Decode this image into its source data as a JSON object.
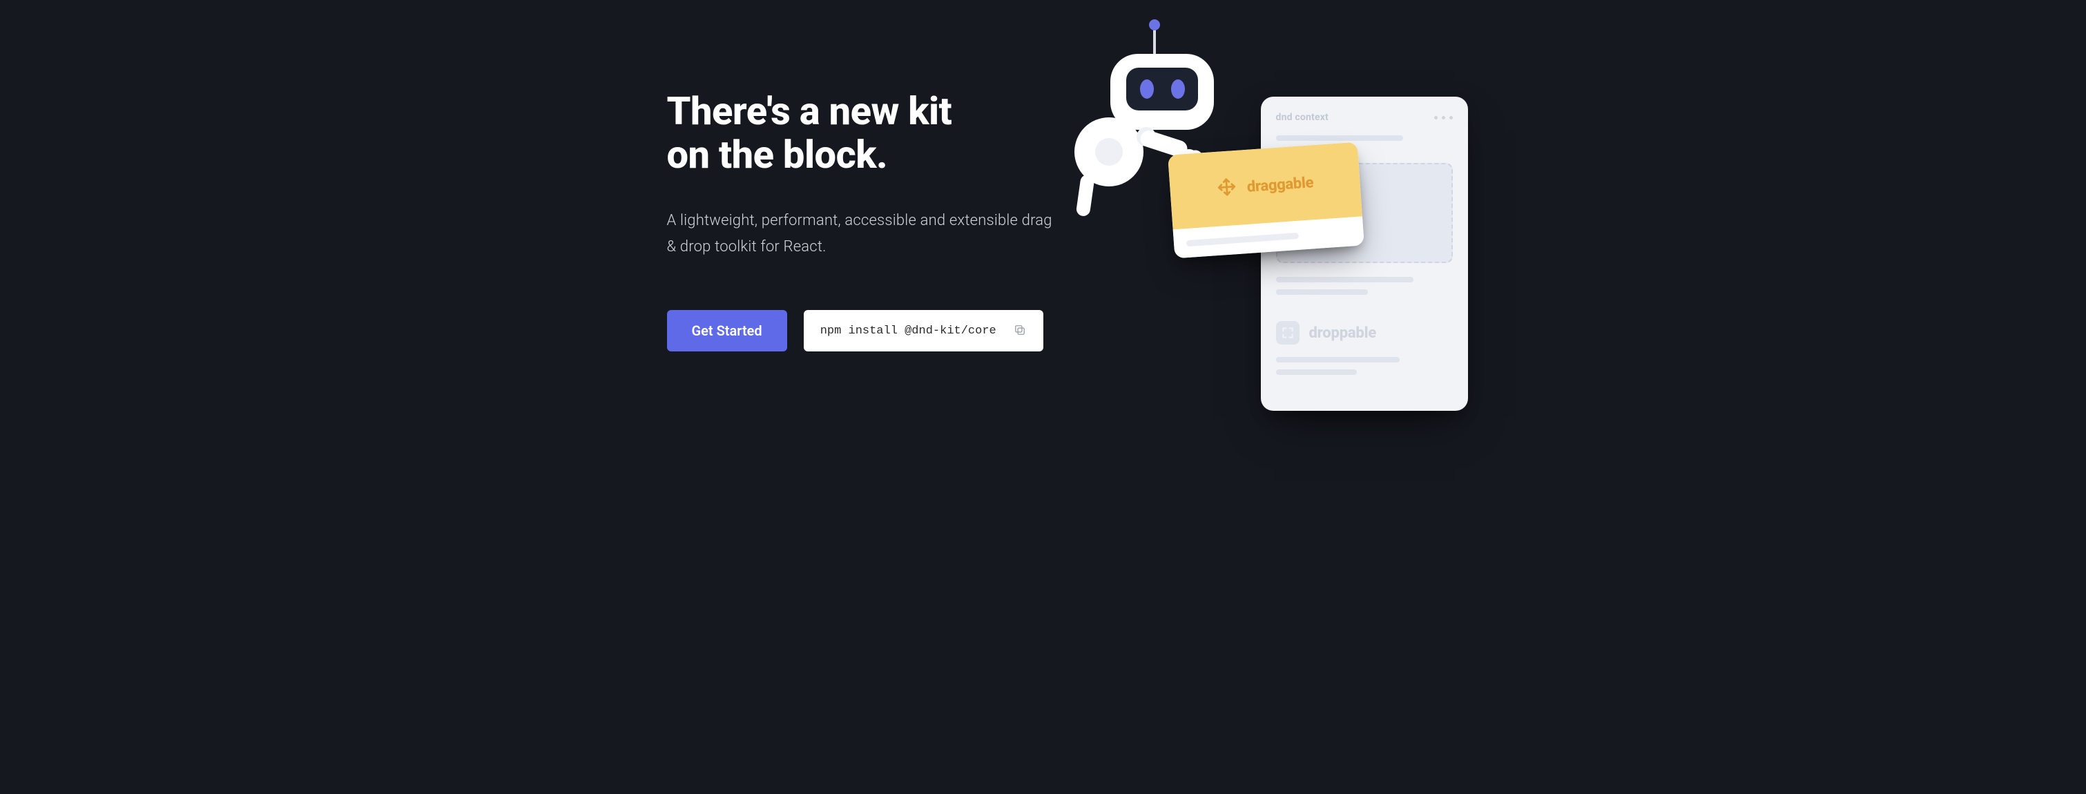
{
  "hero": {
    "title_line1": "There's a new kit",
    "title_line2": "on the block.",
    "subtitle": "A lightweight, performant, accessible and extensible drag & drop toolkit for React.",
    "cta_label": "Get Started",
    "install_cmd": "npm install @dnd-kit/core"
  },
  "illustration": {
    "panel_title": "dnd context",
    "draggable_label": "draggable",
    "droppable_label": "droppable"
  },
  "colors": {
    "bg": "#15181f",
    "accent": "#5f6ae8",
    "card_yellow": "#f7d477",
    "card_yellow_text": "#df9a33"
  }
}
